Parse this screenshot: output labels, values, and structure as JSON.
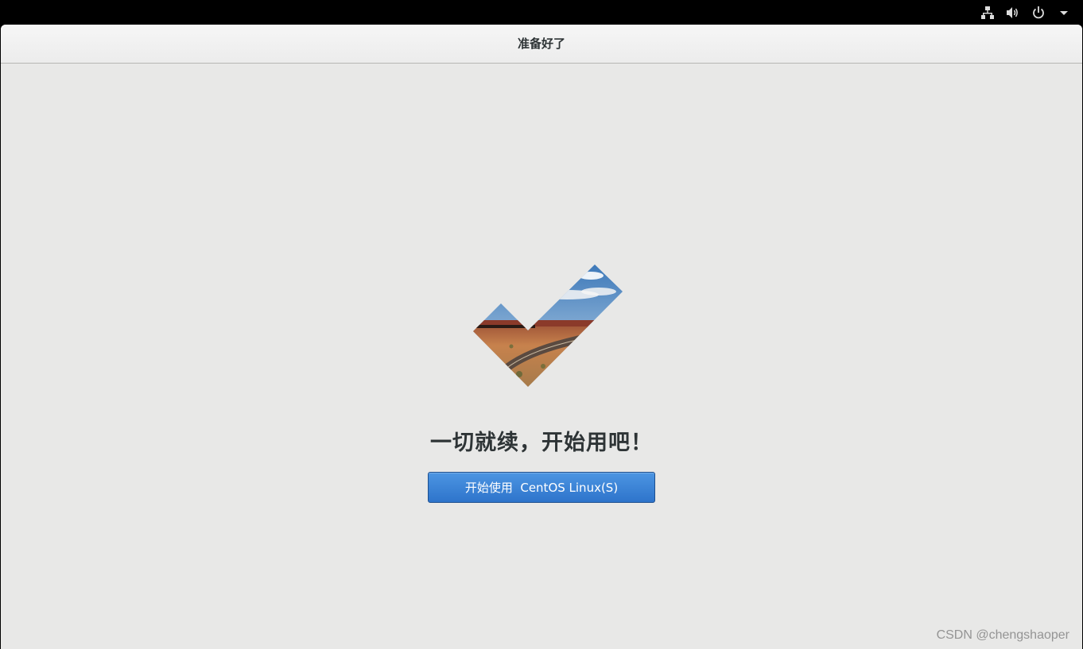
{
  "top_panel": {
    "icons": [
      "network-icon",
      "volume-icon",
      "power-icon",
      "dropdown-arrow-icon"
    ]
  },
  "window": {
    "title": "准备好了"
  },
  "main": {
    "headline": "一切就续，开始用吧！",
    "start_button_label": "开始使用  CentOS Linux(S)"
  },
  "watermark": {
    "text": "CSDN @chengshaoper"
  },
  "colors": {
    "window_bg": "#e8e8e7",
    "button_blue": "#3a82d6",
    "text": "#2e3436"
  }
}
